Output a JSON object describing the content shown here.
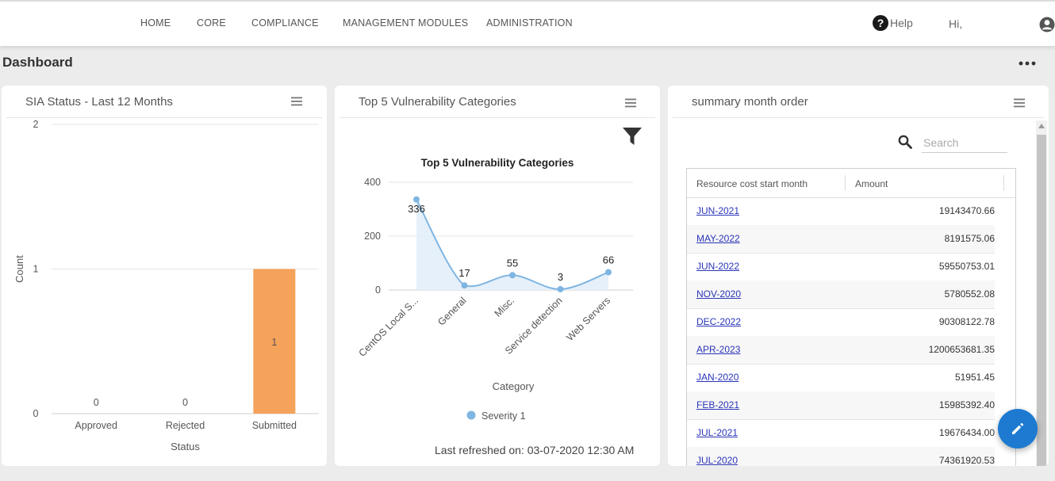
{
  "nav": {
    "items": [
      "HOME",
      "CORE",
      "COMPLIANCE",
      "MANAGEMENT MODULES",
      "ADMINISTRATION"
    ],
    "help_label": "Help",
    "help_icon": "question-circle-icon",
    "greeting": "Hi,",
    "user_icon": "user-circle-icon"
  },
  "page": {
    "title": "Dashboard",
    "more_icon": "more-horizontal-icon"
  },
  "cards": {
    "sia": {
      "title": "SIA Status - Last 12 Months",
      "menu_icon": "hamburger-menu-icon"
    },
    "vuln": {
      "title": "Top 5 Vulnerability Categories",
      "menu_icon": "hamburger-menu-icon",
      "filter_icon": "filter-icon",
      "last_refreshed": "Last refreshed on: 03-07-2020 12:30 AM"
    },
    "summary": {
      "title": "summary month order",
      "menu_icon": "hamburger-menu-icon",
      "search_placeholder": "Search",
      "columns": [
        "Resource cost start month",
        "Amount"
      ],
      "rows": [
        {
          "month": "JUN-2021",
          "amount": "19143470.66"
        },
        {
          "month": "MAY-2022",
          "amount": "8191575.06"
        },
        {
          "month": "JUN-2022",
          "amount": "59550753.01"
        },
        {
          "month": "NOV-2020",
          "amount": "5780552.08"
        },
        {
          "month": "DEC-2022",
          "amount": "90308122.78"
        },
        {
          "month": "APR-2023",
          "amount": "1200653681.35"
        },
        {
          "month": "JAN-2020",
          "amount": "51951.45"
        },
        {
          "month": "FEB-2021",
          "amount": "15985392.40"
        },
        {
          "month": "JUL-2021",
          "amount": "19676434.00"
        },
        {
          "month": "JUL-2020",
          "amount": "74361920.53"
        }
      ]
    }
  },
  "fab_icon": "pencil-edit-icon",
  "colors": {
    "bar": "#f5a25a",
    "line": "#7fb5e2",
    "area": "#e3eef9",
    "link": "#2a35b8",
    "fab": "#1d7ad0"
  },
  "chart_data": [
    {
      "type": "bar",
      "title": "",
      "categories": [
        "Approved",
        "Rejected",
        "Submitted"
      ],
      "values": [
        0,
        0,
        1
      ],
      "data_labels": [
        "0",
        "0",
        "1"
      ],
      "xlabel": "Status",
      "ylabel": "Count",
      "ylim": [
        0,
        2
      ],
      "yticks": [
        0,
        1,
        2
      ],
      "grid": true
    },
    {
      "type": "area",
      "title": "Top 5 Vulnerability Categories",
      "categories": [
        "CentOS Local S...",
        "General",
        "Misc.",
        "Service detection",
        "Web Servers"
      ],
      "series": [
        {
          "name": "Severity 1",
          "values": [
            336,
            17,
            55,
            3,
            66
          ]
        }
      ],
      "xlabel": "Category",
      "ylabel": "",
      "ylim": [
        0,
        400
      ],
      "yticks": [
        0,
        200,
        400
      ],
      "legend": "bottom",
      "grid": true
    }
  ]
}
